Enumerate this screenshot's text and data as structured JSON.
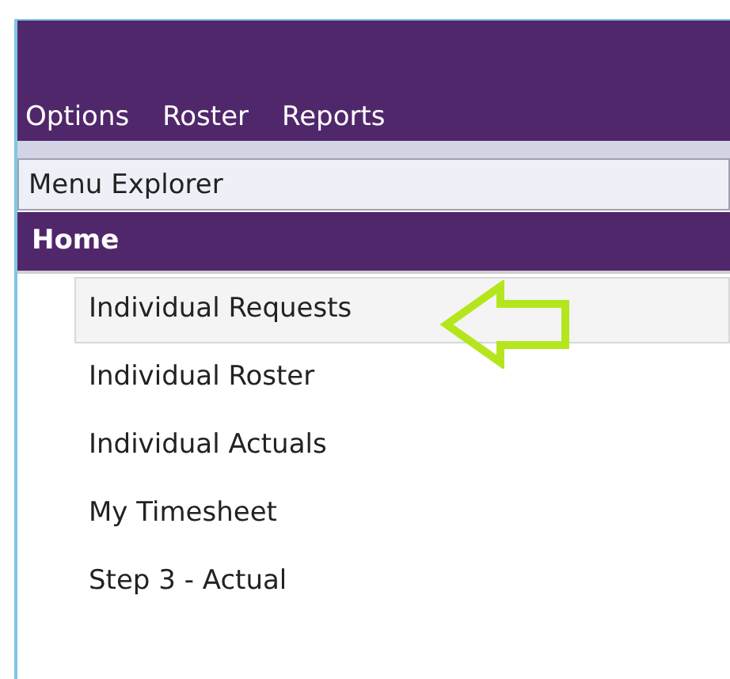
{
  "menu_bar": {
    "items": [
      "Options",
      "Roster",
      "Reports"
    ]
  },
  "menu_explorer": {
    "title": "Menu Explorer"
  },
  "section": {
    "title": "Home"
  },
  "items": [
    {
      "label": "Individual Requests",
      "selected": true
    },
    {
      "label": "Individual Roster",
      "selected": false
    },
    {
      "label": "Individual Actuals",
      "selected": false
    },
    {
      "label": "My Timesheet",
      "selected": false
    },
    {
      "label": "Step 3 - Actual",
      "selected": false
    }
  ]
}
